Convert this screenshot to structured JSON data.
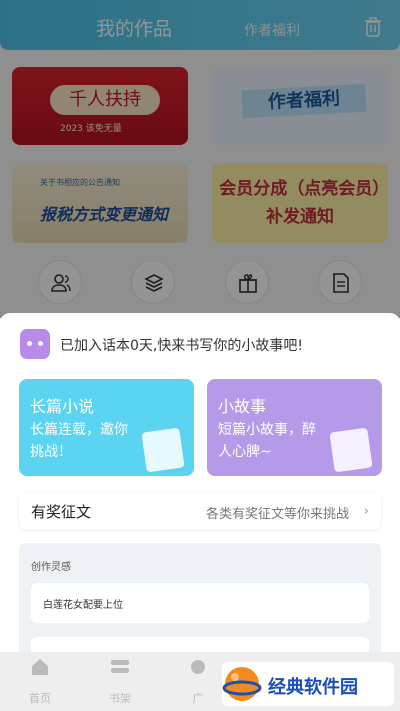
{
  "header": {
    "title": "我的作品",
    "tab2": "作者福利"
  },
  "banners": {
    "b1_title": "千人扶持",
    "b1_sub": "2023 该免无量",
    "b2_title": "作者福利",
    "b3_sub": "关于书相应的公告通知",
    "b3_title": "报税方式变更通知",
    "b4_title": "会员分成（点亮会员）补发通知"
  },
  "quick_icons": [
    "user-group-icon",
    "layers-icon",
    "gift-icon",
    "document-icon"
  ],
  "sheet": {
    "notice": "已加入话本0天,快来书写你的小故事吧!",
    "cards": [
      {
        "title": "长篇小说",
        "desc": "长篇连载，邀你挑战！",
        "color": "#5ad4f0"
      },
      {
        "title": "小故事",
        "desc": "短篇小故事，醉人心脾~",
        "color": "#b49ae8"
      }
    ],
    "contest": {
      "label": "有奖征文",
      "desc": "各类有奖征文等你来挑战",
      "arrow": "›"
    },
    "inspiration": {
      "heading": "创作灵感",
      "items": [
        "白莲花女配要上位",
        ""
      ]
    }
  },
  "nav": {
    "items": [
      "首页",
      "书架",
      "广"
    ]
  },
  "watermark": {
    "text": "经典软件园"
  }
}
